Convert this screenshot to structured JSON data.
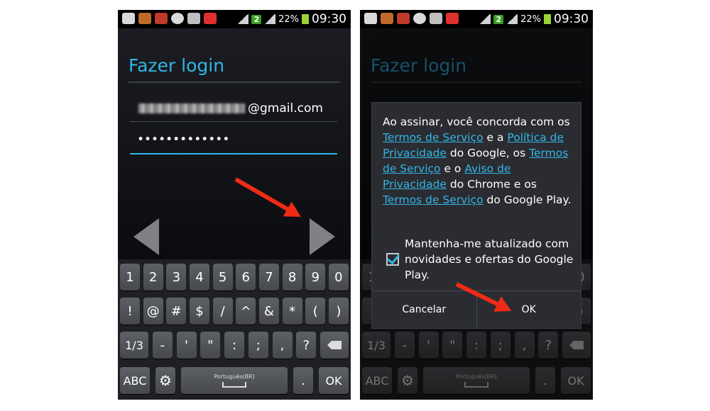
{
  "status_bar": {
    "signal_badge": "2",
    "battery": "22%",
    "time": "09:30"
  },
  "screen": {
    "title": "Fazer login",
    "email_suffix": "@gmail.com",
    "password_mask": "•••••••••••••"
  },
  "keyboard": {
    "row1": [
      "1",
      "2",
      "3",
      "4",
      "5",
      "6",
      "7",
      "8",
      "9",
      "0"
    ],
    "row2": [
      "!",
      "@",
      "#",
      "$",
      "/",
      "^",
      "&",
      "*",
      "(",
      ")"
    ],
    "row3": [
      "1/3",
      "-",
      "'",
      "\"",
      ":",
      ";",
      ",",
      "?"
    ],
    "abc": "ABC",
    "space": "Português(BR)",
    "period": ".",
    "ok": "OK"
  },
  "dialog": {
    "t1": "Ao assinar, você concorda com os ",
    "link_terms": "Termos de Serviço",
    "t2": " e a ",
    "link_privacy": "Política de Privacidade",
    "t3": " do Google, os ",
    "link_terms2": " Termos de Serviço",
    "t4": " e o ",
    "link_notice": " Aviso de Privacidade",
    "t5": " do Chrome e os ",
    "link_terms3": "Termos de Serviço",
    "t6": " do Google Play.",
    "checkbox_label": "Mantenha-me atualizado com novidades e ofertas do Google Play.",
    "checkbox_checked": true,
    "cancel": "Cancelar",
    "ok": "OK"
  },
  "colors": {
    "accent": "#33b5e5",
    "annotation_arrow": "#ef2b15"
  }
}
